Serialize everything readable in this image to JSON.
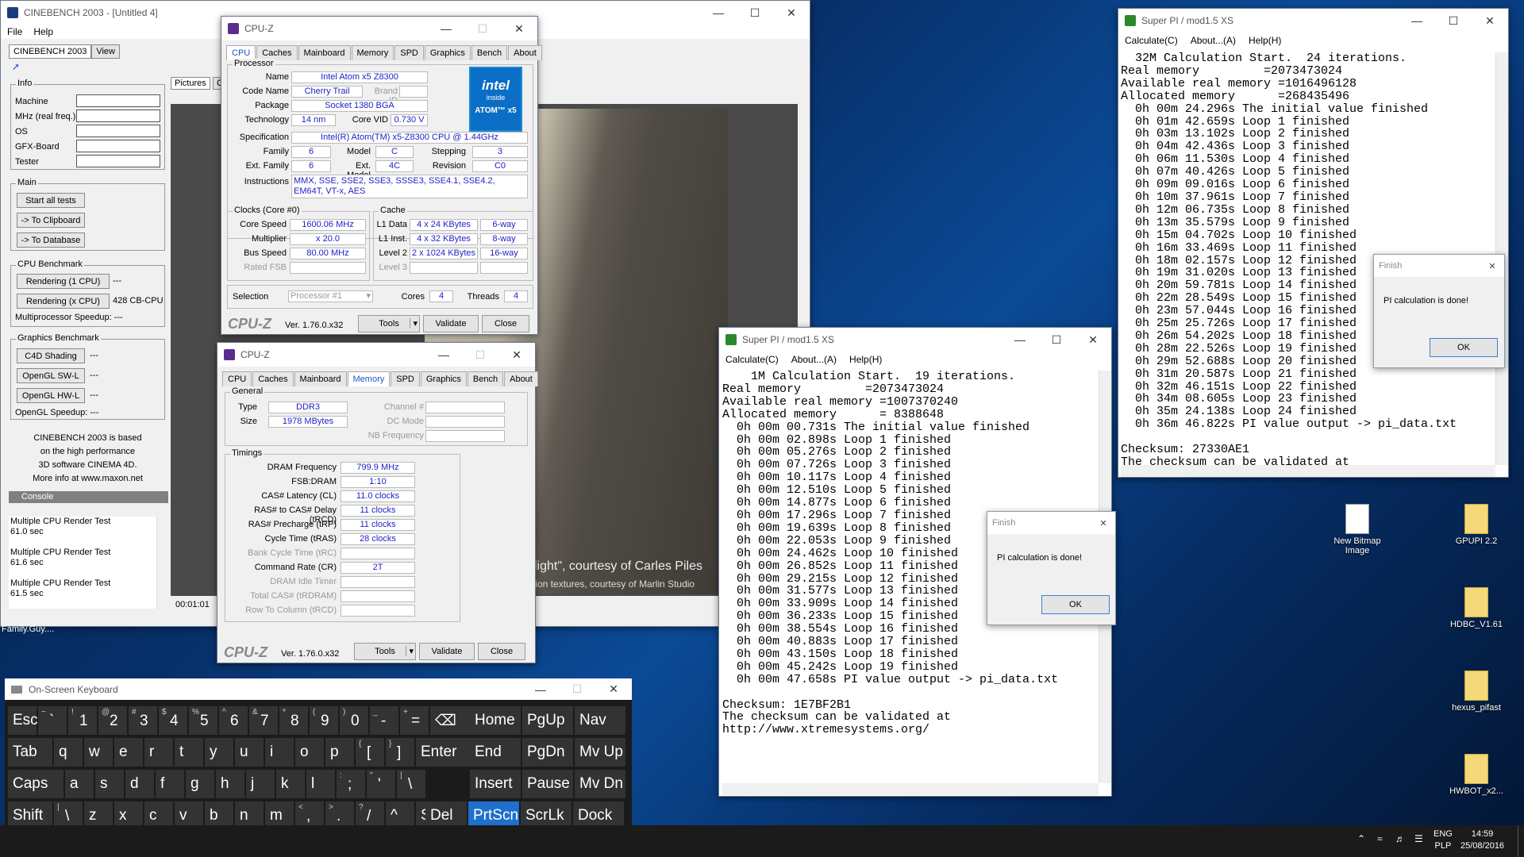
{
  "cinebench": {
    "title": "CINEBENCH 2003 - [Untitled 4]",
    "menu": [
      "File",
      "Help"
    ],
    "tabs": [
      "CINEBENCH 2003",
      "View"
    ],
    "info_header": "Info",
    "info_labels": [
      "Machine",
      "MHz (real freq.)",
      "OS",
      "GFX-Board",
      "Tester"
    ],
    "main_header": "Main",
    "start_all": "Start all tests",
    "to_clipboard": "-> To Clipboard",
    "to_database": "-> To Database",
    "cpu_bench_header": "CPU Benchmark",
    "render1": "Rendering (1 CPU)",
    "render1_val": "---",
    "renderx": "Rendering (x CPU)",
    "renderx_val": "428 CB-CPU",
    "mp_speedup": "Multiprocessor Speedup: ---",
    "gfx_header": "Graphics Benchmark",
    "c4d_shading": "C4D Shading",
    "ogl_sw": "OpenGL SW-L",
    "ogl_hw": "OpenGL HW-L",
    "gfx_val": "---",
    "ogl_speedup": "OpenGL Speedup: ---",
    "about_text": [
      "CINEBENCH 2003 is based",
      "on the high performance",
      "3D software CINEMA 4D.",
      "More info at www.maxon.net"
    ],
    "console_header": "Console",
    "console_lines": [
      "Multiple CPU Render Test",
      "61.0 sec",
      "Multiple CPU Render Test",
      "61.6 sec",
      "Multiple CPU Render Test",
      "61.5 sec"
    ],
    "pictures_tab": "Pictures",
    "pictures_tab2": "C",
    "caption1": "light\", courtesy of Carles Piles",
    "caption2": "tion textures, courtesy of Marlin Studio",
    "timer": "00:01:01"
  },
  "desktop_text": "Family.Guy....",
  "cpuz_cpu": {
    "title": "CPU-Z",
    "tabs": [
      "CPU",
      "Caches",
      "Mainboard",
      "Memory",
      "SPD",
      "Graphics",
      "Bench",
      "About"
    ],
    "active": "CPU",
    "processor_header": "Processor",
    "name_label": "Name",
    "name": "Intel Atom x5 Z8300",
    "codename_label": "Code Name",
    "codename": "Cherry Trail",
    "brandid_label": "Brand ID",
    "package_label": "Package",
    "package": "Socket 1380 BGA",
    "tech_label": "Technology",
    "tech": "14 nm",
    "corevid_label": "Core VID",
    "corevid": "0.730 V",
    "spec_label": "Specification",
    "spec": "Intel(R) Atom(TM) x5-Z8300  CPU @ 1.44GHz",
    "family_label": "Family",
    "family": "6",
    "model_label": "Model",
    "model": "C",
    "stepping_label": "Stepping",
    "stepping": "3",
    "extfamily_label": "Ext. Family",
    "extfamily": "6",
    "extmodel_label": "Ext. Model",
    "extmodel": "4C",
    "revision_label": "Revision",
    "revision": "C0",
    "instr_label": "Instructions",
    "instr": "MMX, SSE, SSE2, SSE3, SSSE3, SSE4.1, SSE4.2, EM64T, VT-x, AES",
    "logo_top": "intel",
    "logo_mid": "inside",
    "logo_bot": "ATOM™ x5",
    "clocks_header": "Clocks (Core #0)",
    "corespeed_label": "Core Speed",
    "corespeed": "1600.06 MHz",
    "mult_label": "Multiplier",
    "mult": "x 20.0",
    "bus_label": "Bus Speed",
    "bus": "80.00 MHz",
    "fsb_label": "Rated FSB",
    "cache_header": "Cache",
    "l1d_label": "L1 Data",
    "l1d": "4 x 24 KBytes",
    "l1d_way": "6-way",
    "l1i_label": "L1 Inst.",
    "l1i": "4 x 32 KBytes",
    "l1i_way": "8-way",
    "l2_label": "Level 2",
    "l2": "2 x 1024 KBytes",
    "l2_way": "16-way",
    "l3_label": "Level 3",
    "selection_label": "Selection",
    "selection": "Processor #1",
    "cores_label": "Cores",
    "cores": "4",
    "threads_label": "Threads",
    "threads": "4",
    "brand": "CPU-Z",
    "version": "Ver. 1.76.0.x32",
    "tools": "Tools",
    "validate": "Validate",
    "close": "Close"
  },
  "cpuz_mem": {
    "title": "CPU-Z",
    "tabs": [
      "CPU",
      "Caches",
      "Mainboard",
      "Memory",
      "SPD",
      "Graphics",
      "Bench",
      "About"
    ],
    "active": "Memory",
    "general_header": "General",
    "type_label": "Type",
    "type": "DDR3",
    "size_label": "Size",
    "size": "1978 MBytes",
    "channel_label": "Channel #",
    "dcmode_label": "DC Mode",
    "nbfreq_label": "NB Frequency",
    "timings_header": "Timings",
    "timings": [
      {
        "label": "DRAM Frequency",
        "value": "799.9 MHz",
        "enabled": true
      },
      {
        "label": "FSB:DRAM",
        "value": "1:10",
        "enabled": true
      },
      {
        "label": "CAS# Latency (CL)",
        "value": "11.0 clocks",
        "enabled": true
      },
      {
        "label": "RAS# to CAS# Delay (tRCD)",
        "value": "11 clocks",
        "enabled": true
      },
      {
        "label": "RAS# Precharge (tRP)",
        "value": "11 clocks",
        "enabled": true
      },
      {
        "label": "Cycle Time (tRAS)",
        "value": "28 clocks",
        "enabled": true
      },
      {
        "label": "Bank Cycle Time (tRC)",
        "value": "",
        "enabled": false
      },
      {
        "label": "Command Rate (CR)",
        "value": "2T",
        "enabled": true
      },
      {
        "label": "DRAM Idle Timer",
        "value": "",
        "enabled": false
      },
      {
        "label": "Total CAS# (tRDRAM)",
        "value": "",
        "enabled": false
      },
      {
        "label": "Row To Column (tRCD)",
        "value": "",
        "enabled": false
      }
    ],
    "brand": "CPU-Z",
    "version": "Ver. 1.76.0.x32",
    "tools": "Tools",
    "validate": "Validate",
    "close": "Close"
  },
  "superpi_32m": {
    "title": "Super PI / mod1.5 XS",
    "menu": [
      "Calculate(C)",
      "About...(A)",
      "Help(H)"
    ],
    "text": "  32M Calculation Start.  24 iterations.\nReal memory         =2073473024\nAvailable real memory =1016496128\nAllocated memory      =268435496\n  0h 00m 24.296s The initial value finished\n  0h 01m 42.659s Loop 1 finished\n  0h 03m 13.102s Loop 2 finished\n  0h 04m 42.436s Loop 3 finished\n  0h 06m 11.530s Loop 4 finished\n  0h 07m 40.426s Loop 5 finished\n  0h 09m 09.016s Loop 6 finished\n  0h 10m 37.961s Loop 7 finished\n  0h 12m 06.735s Loop 8 finished\n  0h 13m 35.579s Loop 9 finished\n  0h 15m 04.702s Loop 10 finished\n  0h 16m 33.469s Loop 11 finished\n  0h 18m 02.157s Loop 12 finished\n  0h 19m 31.020s Loop 13 finished\n  0h 20m 59.781s Loop 14 finished\n  0h 22m 28.549s Loop 15 finished\n  0h 23m 57.044s Loop 16 finished\n  0h 25m 25.726s Loop 17 finished\n  0h 26m 54.202s Loop 18 finished\n  0h 28m 22.526s Loop 19 finished\n  0h 29m 52.688s Loop 20 finished\n  0h 31m 20.587s Loop 21 finished\n  0h 32m 46.151s Loop 22 finished\n  0h 34m 08.605s Loop 23 finished\n  0h 35m 24.138s Loop 24 finished\n  0h 36m 46.822s PI value output -> pi_data.txt\n\nChecksum: 27330AE1\nThe checksum can be validated at"
  },
  "superpi_1m": {
    "title": "Super PI / mod1.5 XS",
    "menu": [
      "Calculate(C)",
      "About...(A)",
      "Help(H)"
    ],
    "text": "    1M Calculation Start.  19 iterations.\nReal memory         =2073473024\nAvailable real memory =1007370240\nAllocated memory      = 8388648\n  0h 00m 00.731s The initial value finished\n  0h 00m 02.898s Loop 1 finished\n  0h 00m 05.276s Loop 2 finished\n  0h 00m 07.726s Loop 3 finished\n  0h 00m 10.117s Loop 4 finished\n  0h 00m 12.510s Loop 5 finished\n  0h 00m 14.877s Loop 6 finished\n  0h 00m 17.296s Loop 7 finished\n  0h 00m 19.639s Loop 8 finished\n  0h 00m 22.053s Loop 9 finished\n  0h 00m 24.462s Loop 10 finished\n  0h 00m 26.852s Loop 11 finished\n  0h 00m 29.215s Loop 12 finished\n  0h 00m 31.577s Loop 13 finished\n  0h 00m 33.909s Loop 14 finished\n  0h 00m 36.233s Loop 15 finished\n  0h 00m 38.554s Loop 16 finished\n  0h 00m 40.883s Loop 17 finished\n  0h 00m 43.150s Loop 18 finished\n  0h 00m 45.242s Loop 19 finished\n  0h 00m 47.658s PI value output -> pi_data.txt\n\nChecksum: 1E7BF2B1\nThe checksum can be validated at\nhttp://www.xtremesystems.org/"
  },
  "finish_dialog": {
    "title": "Finish",
    "message": "PI calculation is done!",
    "ok": "OK"
  },
  "osk": {
    "title": "On-Screen Keyboard",
    "row1": [
      {
        "m": "Esc"
      },
      {
        "s": "~",
        "m": "`"
      },
      {
        "s": "!",
        "m": "1"
      },
      {
        "s": "@",
        "m": "2"
      },
      {
        "s": "#",
        "m": "3"
      },
      {
        "s": "$",
        "m": "4"
      },
      {
        "s": "%",
        "m": "5"
      },
      {
        "s": "^",
        "m": "6"
      },
      {
        "s": "&",
        "m": "7"
      },
      {
        "s": "*",
        "m": "8"
      },
      {
        "s": "(",
        "m": "9"
      },
      {
        "s": ")",
        "m": "0"
      },
      {
        "s": "_",
        "m": "-"
      },
      {
        "s": "+",
        "m": "="
      },
      {
        "m": "⌫"
      }
    ],
    "row2": [
      {
        "m": "Tab"
      },
      {
        "m": "q"
      },
      {
        "m": "w"
      },
      {
        "m": "e"
      },
      {
        "m": "r"
      },
      {
        "m": "t"
      },
      {
        "m": "y"
      },
      {
        "m": "u"
      },
      {
        "m": "i"
      },
      {
        "m": "o"
      },
      {
        "m": "p"
      },
      {
        "s": "{",
        "m": "["
      },
      {
        "s": "}",
        "m": "]"
      },
      {
        "m": "Enter"
      }
    ],
    "row3": [
      {
        "m": "Caps"
      },
      {
        "m": "a"
      },
      {
        "m": "s"
      },
      {
        "m": "d"
      },
      {
        "m": "f"
      },
      {
        "m": "g"
      },
      {
        "m": "h"
      },
      {
        "m": "j"
      },
      {
        "m": "k"
      },
      {
        "m": "l"
      },
      {
        "s": ":",
        "m": ";"
      },
      {
        "s": "\"",
        "m": "'"
      },
      {
        "s": "|",
        "m": "\\"
      }
    ],
    "row4": [
      {
        "m": "Shift"
      },
      {
        "s": "|",
        "m": "\\"
      },
      {
        "m": "z"
      },
      {
        "m": "x"
      },
      {
        "m": "c"
      },
      {
        "m": "v"
      },
      {
        "m": "b"
      },
      {
        "m": "n"
      },
      {
        "m": "m"
      },
      {
        "s": "<",
        "m": ","
      },
      {
        "s": ">",
        "m": "."
      },
      {
        "s": "?",
        "m": "/"
      },
      {
        "m": "^"
      },
      {
        "m": "Shift"
      }
    ],
    "nav1": [
      "Home",
      "PgUp",
      "Nav"
    ],
    "nav2": [
      "End",
      "PgDn",
      "Mv Up"
    ],
    "nav3": [
      "Insert",
      "Pause",
      "Mv Dn"
    ],
    "nav4": [
      "Del",
      "PrtScn",
      "ScrLk",
      "Dock"
    ]
  },
  "desktop_icons": [
    {
      "label": "New Bitmap Image"
    },
    {
      "label": "GPUPI 2.2"
    },
    {
      "label": "HDBC_V1.61"
    },
    {
      "label": "hexus_pifast"
    },
    {
      "label": "HWBOT_x2..."
    }
  ],
  "taskbar": {
    "lang1": "ENG",
    "lang2": "PLP",
    "time": "14:59",
    "date": "25/08/2016"
  }
}
